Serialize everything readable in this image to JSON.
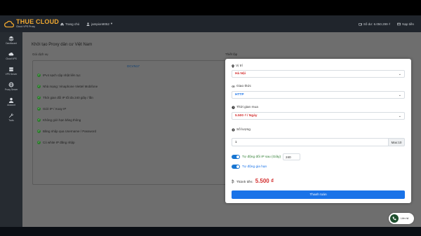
{
  "header": {
    "brand": "THUE CLOUD",
    "brand_sub": "Cloud VPS Proxy",
    "home": "Trang chủ",
    "user": "jampion9052",
    "balance": "Số dư: 6.050.299 ₫",
    "topup": "Nạp tiền"
  },
  "sidebar": {
    "items": [
      {
        "label": "Dashboard",
        "icon": "layers-icon"
      },
      {
        "label": "Cloud VPS",
        "icon": "cloud-icon"
      },
      {
        "label": "VPS Server",
        "icon": "server-icon"
      },
      {
        "label": "Proxy Server",
        "icon": "globe-icon"
      },
      {
        "label": "Account",
        "icon": "user-icon"
      },
      {
        "label": "Tools",
        "icon": "wrench-icon"
      }
    ]
  },
  "page": {
    "title": "Khởi tạo Proxy dân cư Việt Nam",
    "package_label": "Gói dịch vụ",
    "settings_label": "Thiết lập",
    "package_name": "DCVN17",
    "features": [
      "IPv4 sạch cập nhật liên tục",
      "Nhà mạng: Vinaphone Viettel Mobifone",
      "Thời gian đổi IP tối đa 240 giây / lần",
      "Giới IP / Xoay IP",
      "Không giới hạn băng thông",
      "Băng nhập qua Username / Password",
      "Có white IP đăng nhập"
    ]
  },
  "modal": {
    "location_label": "Vị trí",
    "location_value": "Hà Nội",
    "protocol_label": "Giao thức",
    "protocol_value": "HTTP",
    "duration_label": "Thời gian mua",
    "duration_value": "5.500 ₫ / Ngày",
    "quantity_label": "Số lượng",
    "quantity_value": "1",
    "quantity_max": "Max:10",
    "auto_ip_label": "Tự động đổi IP sau (Giây)",
    "auto_ip_value": "240",
    "auto_renew_label": "Tự động gia hạn",
    "total_label": "Thành tiền:",
    "total_value": "5.500 ₫",
    "pay_button": "Thanh toán"
  },
  "chat": {
    "label": "Liên hệ"
  },
  "colors": {
    "accent": "#1a73e8",
    "price": "#d32f2f",
    "brand": "#f0a830",
    "header_bg": "#20252c",
    "sidebar_bg": "#262b31"
  }
}
